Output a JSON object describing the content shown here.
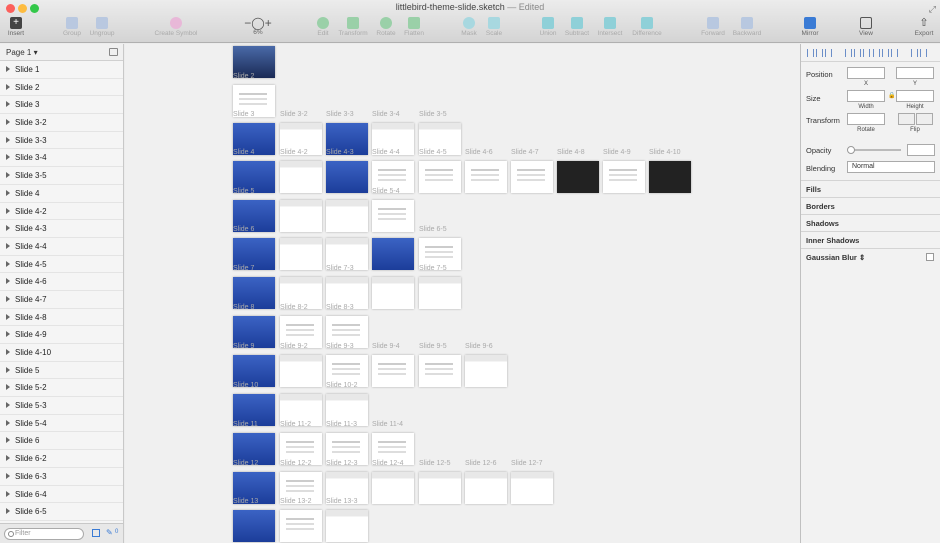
{
  "window": {
    "filename": "littlebird-theme-slide.sketch",
    "edited": "— Edited"
  },
  "toolbar": {
    "insert": "Insert",
    "group": "Group",
    "ungroup": "Ungroup",
    "create_symbol": "Create Symbol",
    "zoom": "6%",
    "edit": "Edit",
    "transform": "Transform",
    "rotate": "Rotate",
    "flatten": "Flatten",
    "mask": "Mask",
    "scale": "Scale",
    "union": "Union",
    "subtract": "Subtract",
    "intersect": "Intersect",
    "difference": "Difference",
    "forward": "Forward",
    "backward": "Backward",
    "mirror": "Mirror",
    "view": "View",
    "export": "Export"
  },
  "sidebar": {
    "page": "Page 1",
    "filter_placeholder": "Filter",
    "count": "0",
    "layers": [
      "Slide 1",
      "Slide 2",
      "Slide 3",
      "Slide 3-2",
      "Slide 3-3",
      "Slide 3-4",
      "Slide 3-5",
      "Slide 4",
      "Slide 4-2",
      "Slide 4-3",
      "Slide 4-4",
      "Slide 4-5",
      "Slide 4-6",
      "Slide 4-7",
      "Slide 4-8",
      "Slide 4-9",
      "Slide 4-10",
      "Slide 5",
      "Slide 5-2",
      "Slide 5-3",
      "Slide 5-4",
      "Slide 6",
      "Slide 6-2",
      "Slide 6-3",
      "Slide 6-4",
      "Slide 6-5"
    ]
  },
  "canvas": {
    "labels": {
      "slide2": "Slide 2",
      "slide3": "Slide 3",
      "s3_2": "Slide 3-2",
      "s3_3": "Slide 3-3",
      "s3_4": "Slide 3-4",
      "s3_5": "Slide 3-5",
      "slide4": "Slide 4",
      "s4_2": "Slide 4-2",
      "s4_3": "Slide 4-3",
      "s4_4": "Slide 4-4",
      "s4_5": "Slide 4-5",
      "s4_6": "Slide 4-6",
      "s4_7": "Slide 4-7",
      "s4_8": "Slide 4-8",
      "s4_9": "Slide 4-9",
      "s4_10": "Slide 4-10",
      "slide5": "Slide 5",
      "s5_4": "Slide 5-4",
      "slide6": "Slide 6",
      "s6_5": "Slide 6-5",
      "slide7": "Slide 7",
      "s7_3": "Slide 7-3",
      "s7_5": "Slide 7-5",
      "slide8": "Slide 8",
      "s8_2": "Slide 8-2",
      "s8_3": "Slide 8-3",
      "slide9": "Slide 9",
      "s9_2": "Slide 9-2",
      "s9_3": "Slide 9-3",
      "s9_4": "Slide 9-4",
      "s9_5": "Slide 9-5",
      "s9_6": "Slide 9-6",
      "slide10": "Slide 10",
      "s10_2": "Slide 10-2",
      "slide11": "Slide 11",
      "s11_2": "Slide 11-2",
      "s11_3": "Slide 11-3",
      "s11_4": "Slide 11-4",
      "slide12": "Slide 12",
      "s12_2": "Slide 12-2",
      "s12_3": "Slide 12-3",
      "s12_4": "Slide 12-4",
      "s12_5": "Slide 12-5",
      "s12_6": "Slide 12-6",
      "s12_7": "Slide 12-7",
      "slide13": "Slide 13",
      "s13_2": "Slide 13-2",
      "s13_3": "Slide 13-3"
    }
  },
  "inspector": {
    "position": "Position",
    "x": "X",
    "y": "Y",
    "size": "Size",
    "width": "Width",
    "height": "Height",
    "transform": "Transform",
    "rotate": "Rotate",
    "flip": "Flip",
    "opacity": "Opacity",
    "blending": "Blending",
    "blending_value": "Normal",
    "fills": "Fills",
    "borders": "Borders",
    "shadows": "Shadows",
    "inner_shadows": "Inner Shadows",
    "gaussian_blur": "Gaussian Blur"
  },
  "colors": {
    "slide_blue": "#2a4fb5",
    "accent": "#3a7bd5"
  }
}
